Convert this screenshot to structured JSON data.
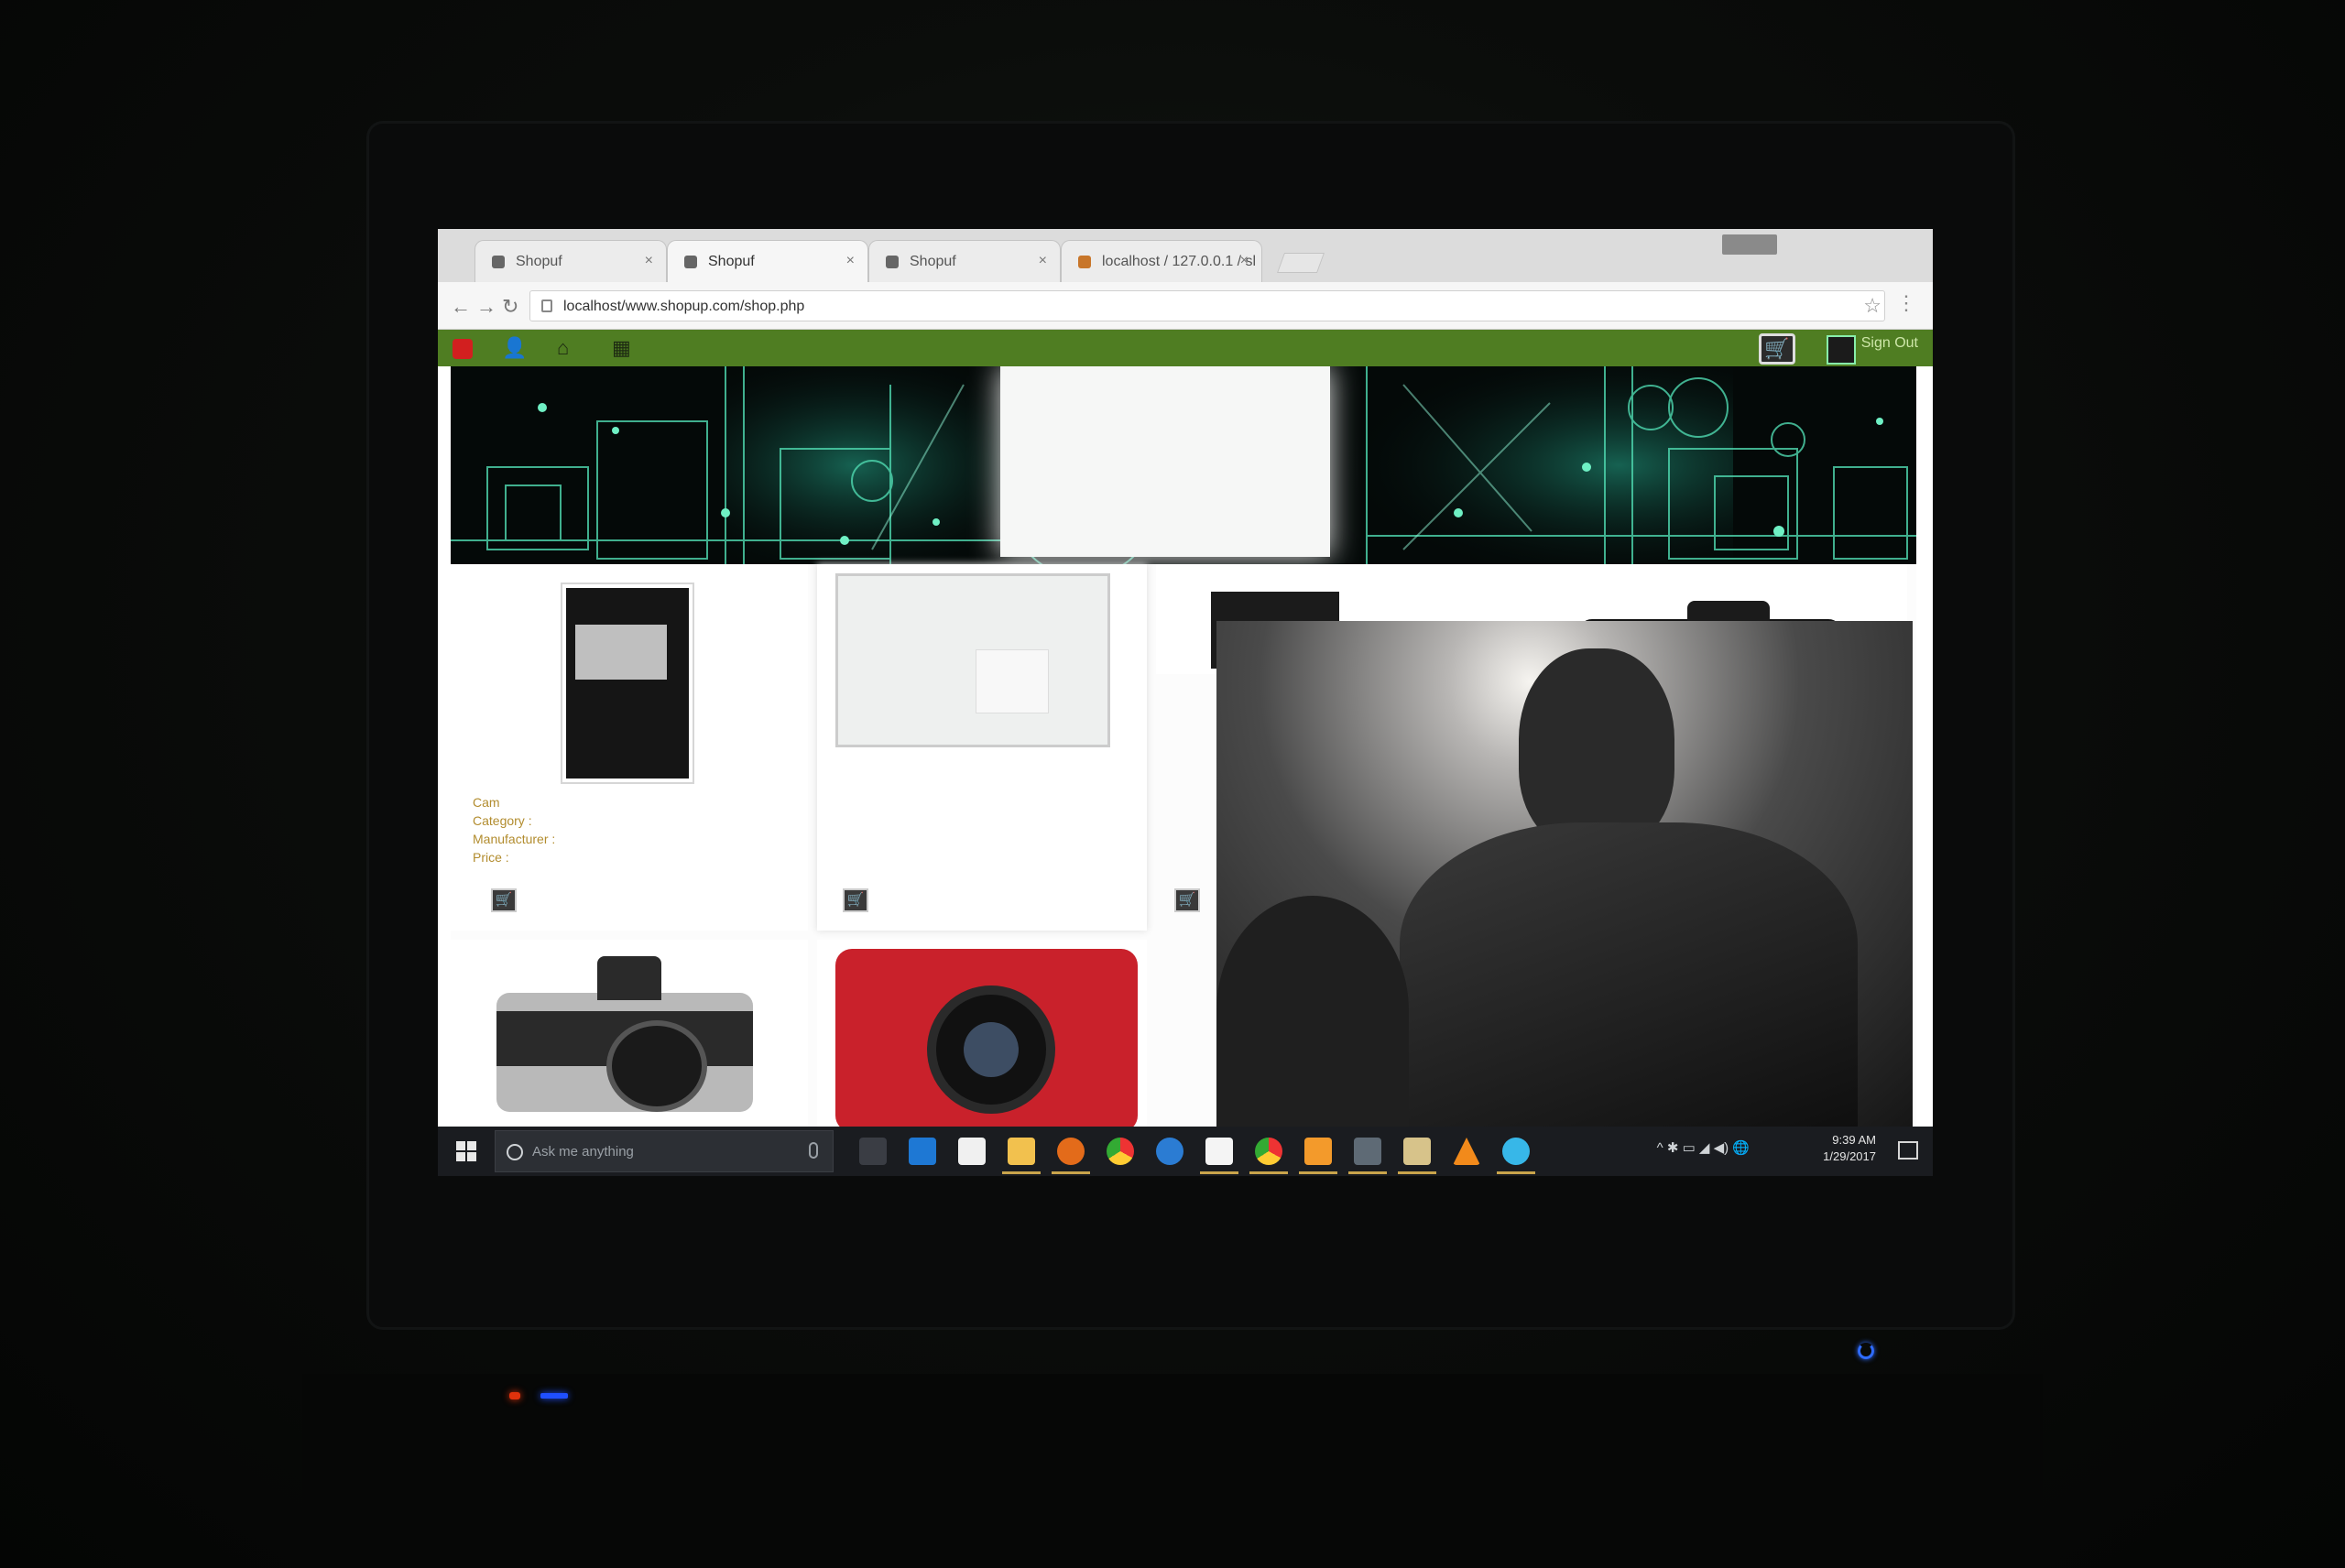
{
  "browser": {
    "tabs": [
      {
        "title": "Shopuf",
        "active": false
      },
      {
        "title": "Shopuf",
        "active": true
      },
      {
        "title": "Shopuf",
        "active": false
      },
      {
        "title": "localhost / 127.0.0.1 / sl",
        "active": false
      }
    ],
    "tab_close": "×",
    "back_icon": "←",
    "forward_icon": "→",
    "reload_icon": "↻",
    "url": "localhost/www.shopup.com/shop.php",
    "star_icon": "☆",
    "menu_icon": "⋮"
  },
  "site": {
    "nav_bg": "#4f7d22",
    "user_icon": "👤",
    "home_icon": "⌂",
    "box_icon": "▦",
    "cart_icon": "🛒",
    "logout_label": "Sign Out",
    "product_meta": {
      "name": "Cam",
      "line1": "Category : ",
      "line2": "Manufacturer : ",
      "line3": "Price : "
    },
    "add_to_cart_icon": "🛒"
  },
  "taskbar": {
    "search_placeholder": "Ask me anything",
    "time": "9:39 AM",
    "date": "1/29/2017",
    "tray_text": "^ ✱ ▭ ◢ ◀) 🌐"
  }
}
